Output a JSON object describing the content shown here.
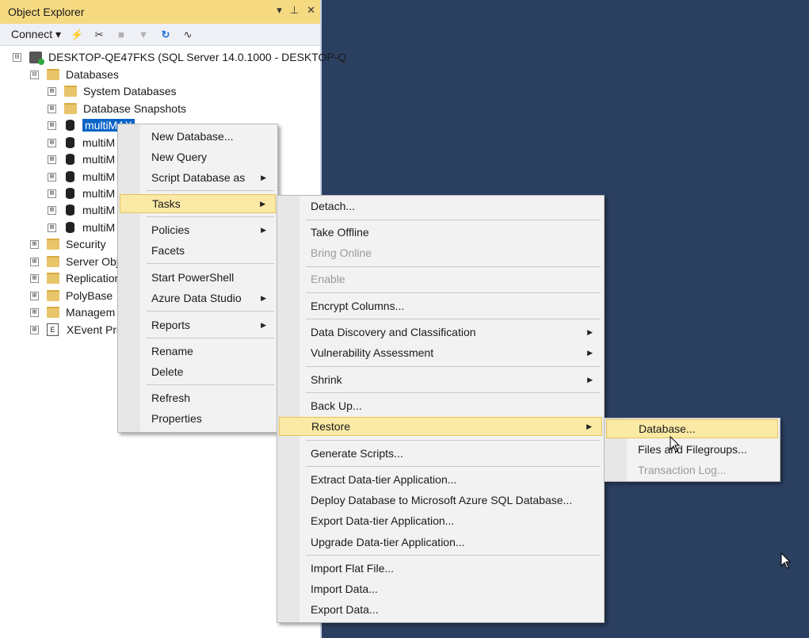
{
  "panel": {
    "title": "Object Explorer",
    "ctrl_pin": "▾",
    "ctrl_dock": "⊥",
    "ctrl_close": "✕",
    "connect_label": "Connect ▾"
  },
  "tree": {
    "server": "DESKTOP-QE47FKS (SQL Server 14.0.1000 - DESKTOP-Q",
    "databases": "Databases",
    "system_databases": "System Databases",
    "database_snapshots": "Database Snapshots",
    "db_items": [
      "multiMAX",
      "multiM",
      "multiM",
      "multiM",
      "multiM",
      "multiM",
      "multiM"
    ],
    "security": "Security",
    "server_objects": "Server Obj",
    "replication": "Replication",
    "polybase": "PolyBase",
    "management": "Managem",
    "xevent": "XEvent Pro"
  },
  "menu1": {
    "new_database": "New Database...",
    "new_query": "New Query",
    "script_database_as": "Script Database as",
    "tasks": "Tasks",
    "policies": "Policies",
    "facets": "Facets",
    "start_powershell": "Start PowerShell",
    "azure_data_studio": "Azure Data Studio",
    "reports": "Reports",
    "rename": "Rename",
    "delete": "Delete",
    "refresh": "Refresh",
    "properties": "Properties"
  },
  "menu2": {
    "detach": "Detach...",
    "take_offline": "Take Offline",
    "bring_online": "Bring Online",
    "enable": "Enable",
    "encrypt_columns": "Encrypt Columns...",
    "data_discovery": "Data Discovery and Classification",
    "vulnerability": "Vulnerability Assessment",
    "shrink": "Shrink",
    "back_up": "Back Up...",
    "restore": "Restore",
    "generate_scripts": "Generate Scripts...",
    "extract_dac": "Extract Data-tier Application...",
    "deploy_azure": "Deploy Database to Microsoft Azure SQL Database...",
    "export_dac": "Export Data-tier Application...",
    "upgrade_dac": "Upgrade Data-tier Application...",
    "import_flat": "Import Flat File...",
    "import_data": "Import Data...",
    "export_data": "Export Data..."
  },
  "menu3": {
    "database": "Database...",
    "files_filegroups": "Files and Filegroups...",
    "transaction_log": "Transaction Log..."
  },
  "icons": {
    "expand": "⊞",
    "collapse": "⊟",
    "submenu_arrow": "▶"
  },
  "colors": {
    "title_bar": "#f5da82",
    "highlight": "#fbeaa6",
    "selection": "#0a64c8",
    "background": "#2b3f61"
  }
}
